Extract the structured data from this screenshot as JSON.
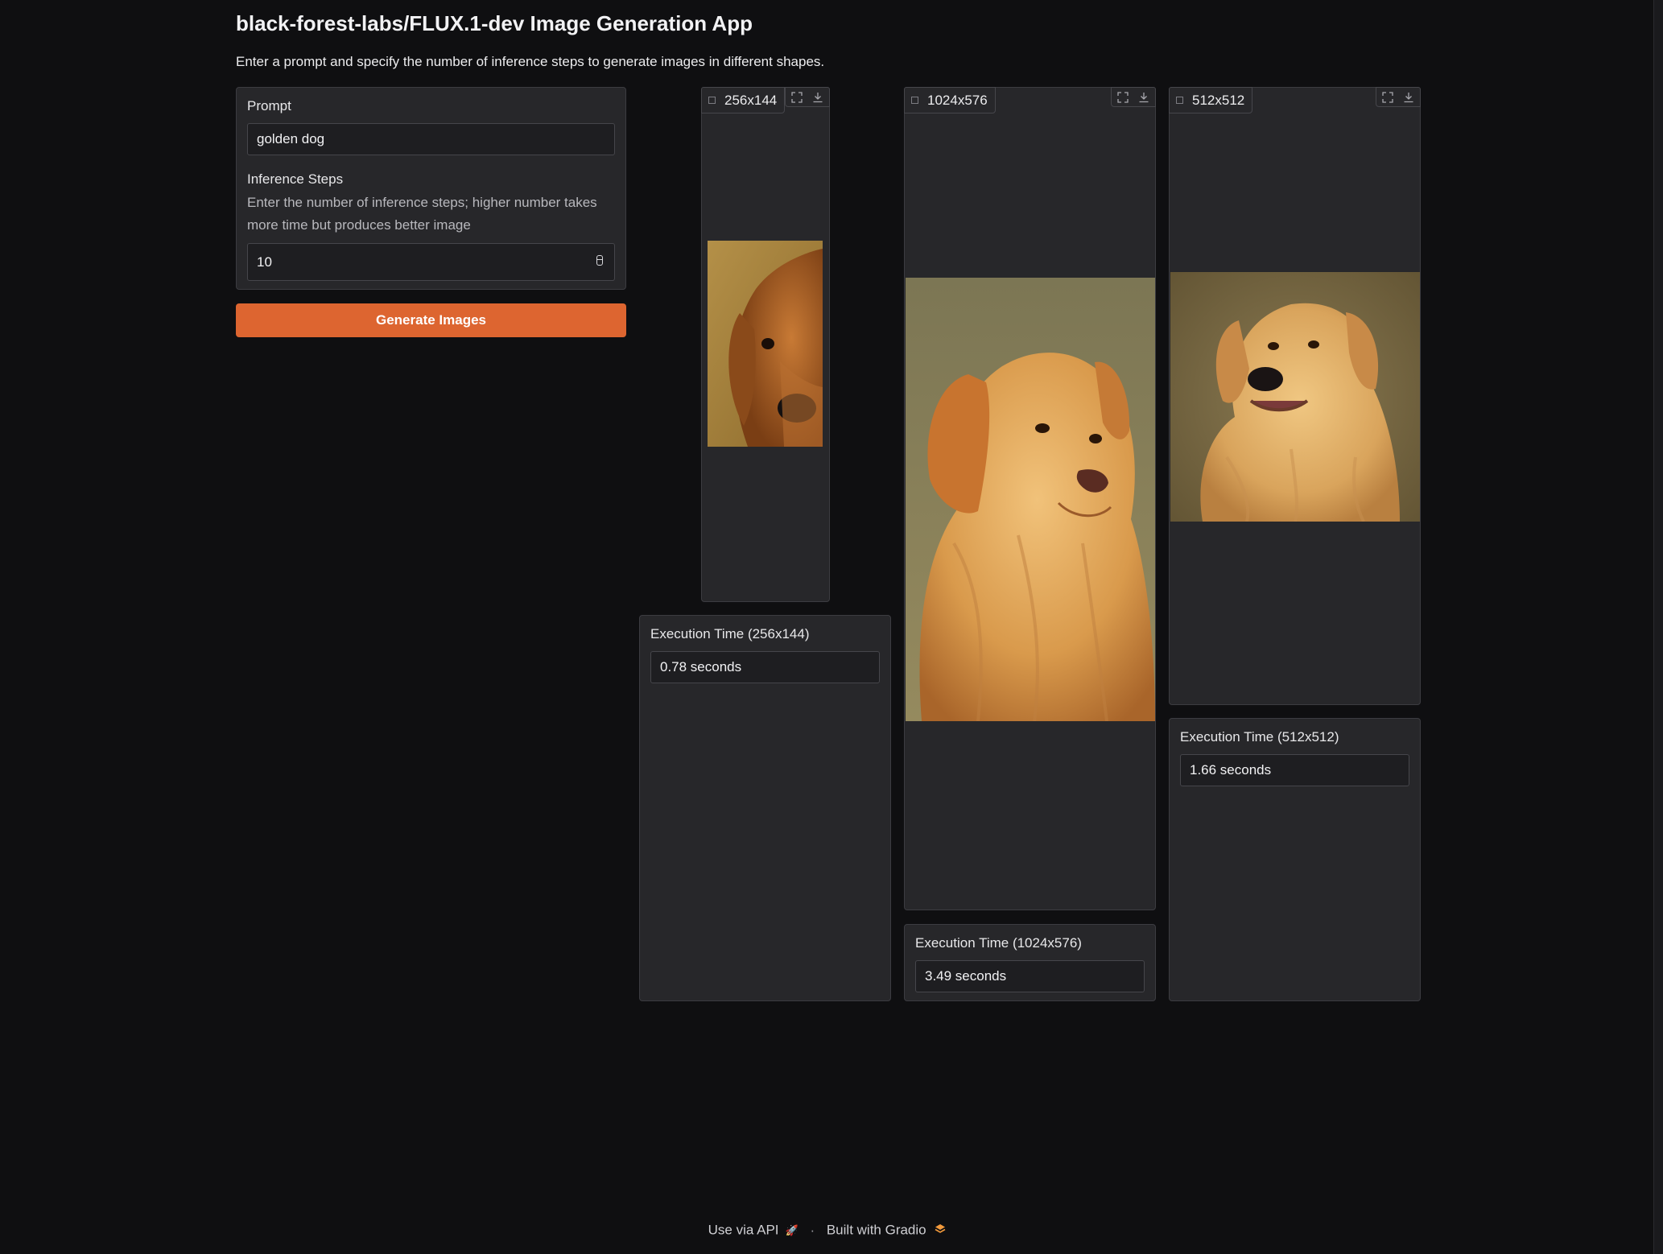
{
  "app": {
    "title": "black-forest-labs/FLUX.1-dev Image Generation App",
    "description": "Enter a prompt and specify the number of inference steps to generate images in different shapes."
  },
  "form": {
    "prompt_label": "Prompt",
    "prompt_value": "golden dog",
    "steps_label": "Inference Steps",
    "steps_info_line1": "Enter the number of inference steps; higher number takes",
    "steps_info_line2": "more time but produces better image",
    "steps_value": "10",
    "generate_label": "Generate Images"
  },
  "outputs": [
    {
      "image_label": "256x144",
      "time_label": "Execution Time (256x144)",
      "time_value": "0.78 seconds"
    },
    {
      "image_label": "1024x576",
      "time_label": "Execution Time (1024x576)",
      "time_value": "3.49 seconds"
    },
    {
      "image_label": "512x512",
      "time_label": "Execution Time (512x512)",
      "time_value": "1.66 seconds"
    }
  ],
  "footer": {
    "api_label": "Use via API",
    "separator": "·",
    "built_label": "Built with Gradio"
  },
  "icons": {
    "image_label": "image-icon",
    "fullscreen": "fullscreen-icon",
    "download": "download-icon",
    "stepper": "number-stepper-icon",
    "api": "rocket-icon",
    "gradio": "gradio-logo"
  },
  "colors": {
    "accent": "#dd6530",
    "background": "#0f0f11",
    "panel": "#27272a",
    "border": "#3c3c41"
  }
}
